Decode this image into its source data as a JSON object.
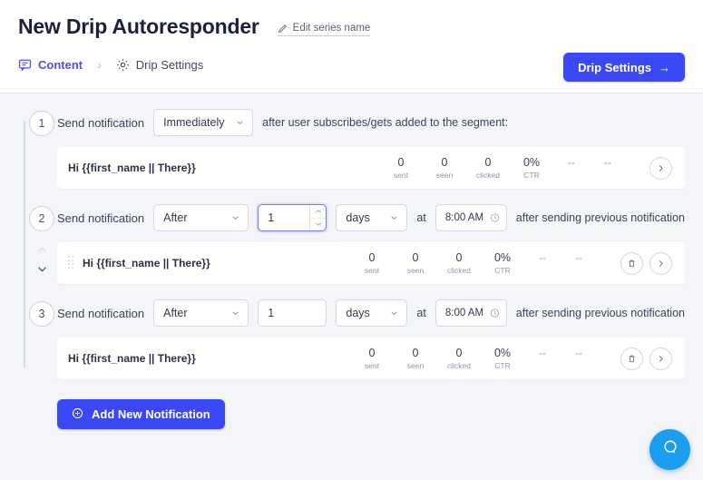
{
  "header": {
    "title": "New Drip Autoresponder",
    "edit_series_label": "Edit series name",
    "pencil_icon": "pencil-icon",
    "tabs": [
      {
        "label": "Content",
        "icon": "chat-bubble-icon",
        "active": true
      },
      {
        "label": "Drip Settings",
        "icon": "gear-icon",
        "active": false
      }
    ],
    "tab_separator": "›",
    "drip_settings_button": {
      "label": "Drip Settings",
      "arrow": "→"
    }
  },
  "steps": [
    {
      "number": "1",
      "send_label": "Send notification",
      "delay_type": "Immediately",
      "trailing_text": "after user subscribes/gets added to the segment:",
      "has_amount": false,
      "notification": {
        "name": "Hi {{first_name || There}}",
        "stats": [
          {
            "value": "0",
            "key": "sent"
          },
          {
            "value": "0",
            "key": "seen"
          },
          {
            "value": "0",
            "key": "clicked"
          },
          {
            "value": "0%",
            "key": "CTR"
          }
        ],
        "dashes": [
          "--",
          "--"
        ],
        "has_delete": false,
        "has_drag_handle": false
      }
    },
    {
      "number": "2",
      "send_label": "Send notification",
      "delay_type": "After",
      "amount": "1",
      "unit": "days",
      "at_label": "at",
      "time": "8:00 AM",
      "trailing_text": "after sending previous notification",
      "has_amount": true,
      "amount_focused": true,
      "notification": {
        "name": "Hi {{first_name || There}}",
        "stats": [
          {
            "value": "0",
            "key": "sent"
          },
          {
            "value": "0",
            "key": "seen"
          },
          {
            "value": "0",
            "key": "clicked"
          },
          {
            "value": "0%",
            "key": "CTR"
          }
        ],
        "dashes": [
          "--",
          "--"
        ],
        "has_delete": true,
        "has_drag_handle": true
      }
    },
    {
      "number": "3",
      "send_label": "Send notification",
      "delay_type": "After",
      "amount": "1",
      "unit": "days",
      "at_label": "at",
      "time": "8:00 AM",
      "trailing_text": "after sending previous notification",
      "has_amount": true,
      "amount_focused": false,
      "notification": {
        "name": "Hi {{first_name || There}}",
        "stats": [
          {
            "value": "0",
            "key": "sent"
          },
          {
            "value": "0",
            "key": "seen"
          },
          {
            "value": "0",
            "key": "clicked"
          },
          {
            "value": "0%",
            "key": "CTR"
          }
        ],
        "dashes": [
          "--",
          "--"
        ],
        "has_delete": true,
        "has_drag_handle": false
      }
    }
  ],
  "footer": {
    "add_notification_label": "Add New Notification",
    "add_icon": "plus-circle-icon"
  },
  "help": {
    "icon": "chat-help-icon"
  },
  "colors": {
    "accent": "#3b48f5",
    "active_tab": "#4b4ff3",
    "help_bubble": "#1b9df0",
    "page_bg": "#f4f5f8"
  }
}
